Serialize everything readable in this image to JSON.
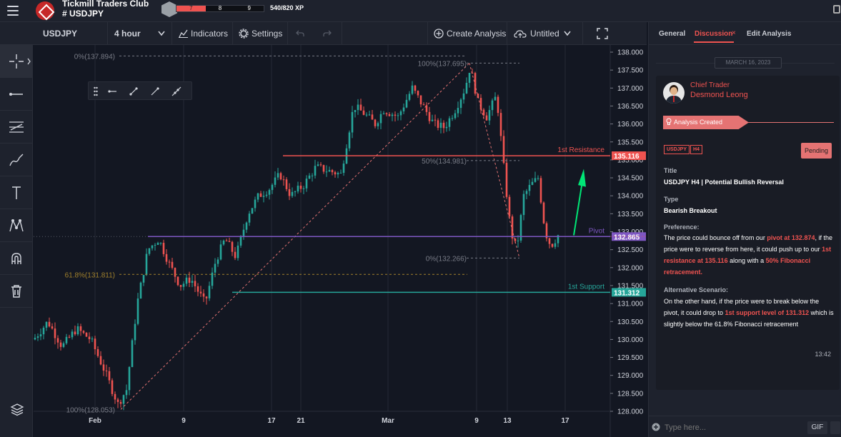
{
  "app": {
    "title": "Tickmill Traders Club",
    "symbol": "# USDJPY",
    "level_segments": [
      "7",
      "8",
      "9"
    ],
    "xp": "540/820 XP"
  },
  "toolbar": {
    "symbol": "USDJPY",
    "interval": "4 hour",
    "indicators": "Indicators",
    "settings": "Settings",
    "create_analysis": "Create Analysis",
    "layout_name": "Untitled"
  },
  "left_tools": [
    "crosshair-icon",
    "trend-line-icon",
    "fib-icon",
    "brush-icon",
    "text-icon",
    "pattern-icon",
    "magnet-icon",
    "trash-icon"
  ],
  "chart_data": {
    "type": "candlestick",
    "symbol": "USDJPY",
    "interval": "4 hour",
    "ylim": [
      128.0,
      138.0
    ],
    "y_ticks": [
      "138.000",
      "137.500",
      "137.000",
      "136.500",
      "136.000",
      "135.500",
      "135.000",
      "134.500",
      "134.000",
      "133.500",
      "133.000",
      "132.500",
      "132.000",
      "131.500",
      "131.000",
      "130.500",
      "130.000",
      "129.500",
      "129.000",
      "128.500",
      "128.000"
    ],
    "x_ticks": [
      "Feb",
      "9",
      "17",
      "21",
      "Mar",
      "9",
      "13",
      "17"
    ],
    "levels": [
      {
        "name": "1st Resistance",
        "value": 135.116,
        "label": "135.116",
        "color": "#ef5350"
      },
      {
        "name": "Pivot",
        "value": 132.865,
        "label": "132.865",
        "color": "#7e57c2"
      },
      {
        "name": "1st Support",
        "value": 131.312,
        "label": "131.312",
        "color": "#26a69a"
      }
    ],
    "fib_labels": [
      "0%(137.894)",
      "61.8%(131.811)",
      "100%(128.053)",
      "100%(137.695)",
      "50%(134.981)",
      "0%(132.266)"
    ]
  },
  "panel": {
    "tabs": [
      "General",
      "Discussion",
      "Edit Analysis"
    ],
    "date": "MARCH 16, 2023",
    "role": "Chief Trader",
    "author": "Desmond Leong",
    "banner": "Analysis Created",
    "tags": [
      "USDJPY",
      "H4"
    ],
    "status": "Pending",
    "title_label": "Title",
    "title": "USDJPY H4 | Potential Bullish Reversal",
    "type_label": "Type",
    "type": "Bearish Breakout",
    "pref_label": "Preference:",
    "pref": {
      "a": "The price could bounce off from our ",
      "b": "pivot at 132.874",
      "c": ", if the price were to reverse from here, it could push up to our ",
      "d": "1st resistance at 135.116",
      "e": " along with a ",
      "f": "50% Fibonacci retracement."
    },
    "alt_label": "Alternative Scenario:",
    "alt": {
      "a": "On the other hand, if the price were to break below the pivot, it could drop to ",
      "b": "1st support level of 131.312",
      "c": " which is slightly below the 61.8% Fibonacci retracement"
    },
    "time": "13:42",
    "input_placeholder": "Type here...",
    "gif": "GIF"
  }
}
